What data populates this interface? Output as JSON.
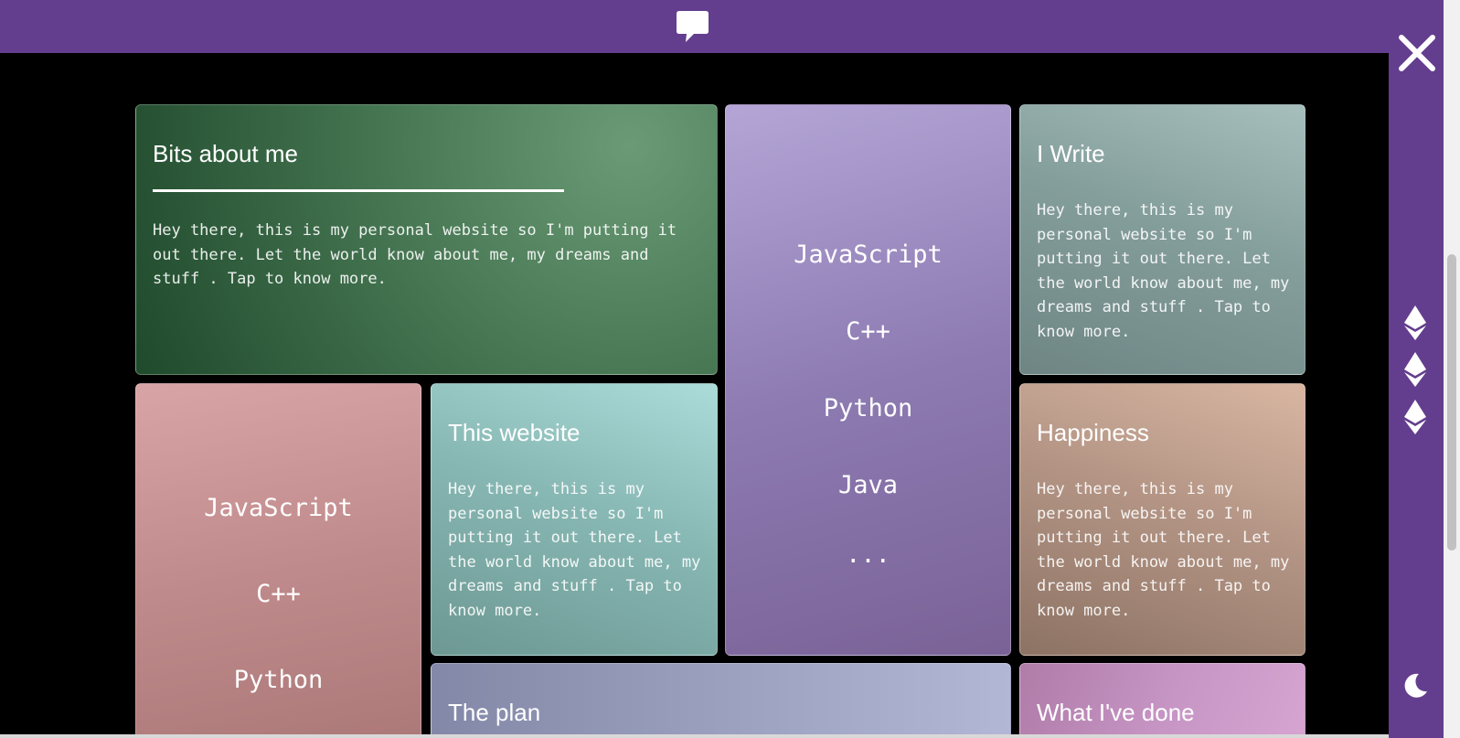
{
  "header": {
    "chat_icon": "chat-bubble-icon"
  },
  "sidebar": {
    "close_icon": "close-icon",
    "nav_icons": [
      "ethereum-icon",
      "ethereum-icon",
      "ethereum-icon"
    ],
    "theme_icon": "moon-icon"
  },
  "cards": {
    "about": {
      "title": "Bits about me",
      "body": "Hey there, this is my personal website so I'm putting it out there. Let the world know about me, my dreams and stuff . Tap to know more."
    },
    "skills_purple": {
      "langs": [
        "JavaScript",
        "C++",
        "Python",
        "Java",
        "..."
      ]
    },
    "write": {
      "title": "I Write",
      "body": "Hey there, this is my personal website so I'm putting it out there. Let the world know about me, my dreams and stuff . Tap to know more."
    },
    "skills_pink": {
      "langs": [
        "JavaScript",
        "C++",
        "Python"
      ]
    },
    "website": {
      "title": "This website",
      "body": "Hey there, this is my personal website so I'm putting it out there. Let the world know about me, my dreams and stuff . Tap to know more."
    },
    "happiness": {
      "title": "Happiness",
      "body": "Hey there, this is my personal website so I'm putting it out there. Let the world know about me, my dreams and stuff . Tap to know more."
    },
    "plan": {
      "title": "The plan"
    },
    "done": {
      "title": "What I've done"
    }
  },
  "colors": {
    "accent": "#643e8e",
    "background": "#000000"
  }
}
